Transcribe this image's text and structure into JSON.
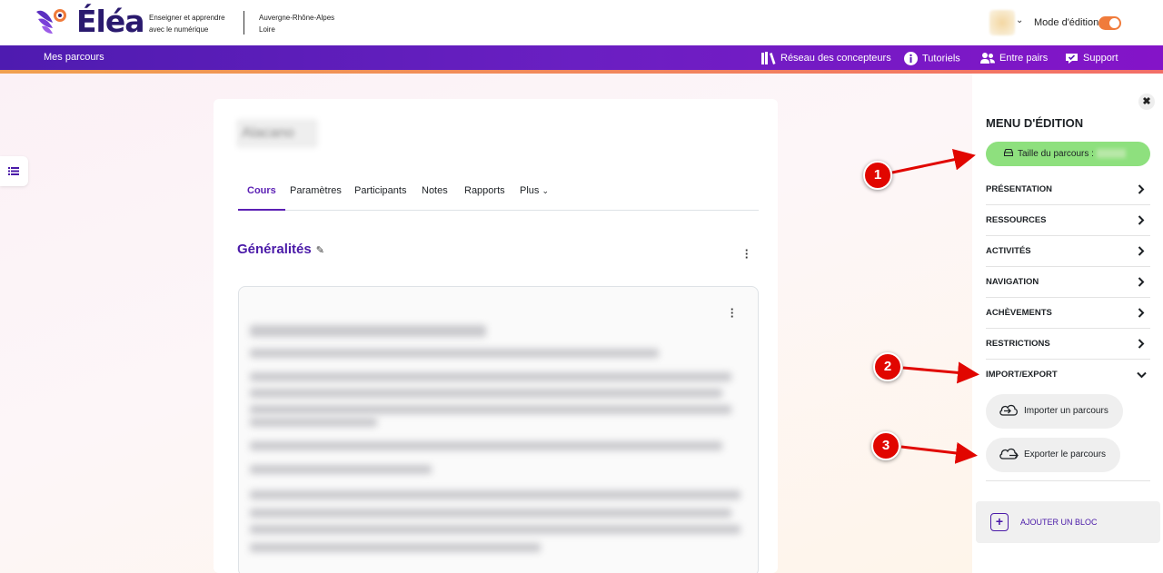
{
  "header": {
    "logo_text": "Éléa",
    "tagline_line1": "Enseigner et apprendre",
    "tagline_line2": "avec le numérique",
    "region_line1": "Auvergne-Rhône-Alpes",
    "region_line2": "Loire",
    "edit_mode_label": "Mode d'édition",
    "edit_mode_on": true
  },
  "navbar": {
    "my_courses": "Mes parcours",
    "items": [
      {
        "label": "Réseau des concepteurs",
        "icon": "books-icon"
      },
      {
        "label": "Tutoriels",
        "icon": "info-icon"
      },
      {
        "label": "Entre pairs",
        "icon": "users-icon"
      },
      {
        "label": "Support",
        "icon": "support-icon"
      }
    ]
  },
  "course": {
    "title": "Alacano",
    "tabs": [
      "Cours",
      "Paramètres",
      "Participants",
      "Notes",
      "Rapports",
      "Plus"
    ],
    "active_tab": "Cours",
    "section_title": "Généralités"
  },
  "drawer": {
    "close_label": "✖",
    "title": "MENU D'ÉDITION",
    "size_label": "Taille du parcours :",
    "menu_items": [
      "PRÉSENTATION",
      "RESSOURCES",
      "ACTIVITÉS",
      "NAVIGATION",
      "ACHÈVEMENTS",
      "RESTRICTIONS",
      "IMPORT/EXPORT"
    ],
    "expanded_item": "IMPORT/EXPORT",
    "import_label": "Importer un parcours",
    "export_label": "Exporter le parcours",
    "add_block_label": "AJOUTER UN BLOC"
  },
  "annotations": [
    "1",
    "2",
    "3"
  ],
  "colors": {
    "brand_purple": "#5b1fb4",
    "nav_gradient_start": "#4e1bb0",
    "nav_gradient_end": "#8414c8",
    "toggle_orange": "#f07b3b",
    "size_pill_green": "#8ee07e",
    "annotation_red": "#e10600"
  }
}
